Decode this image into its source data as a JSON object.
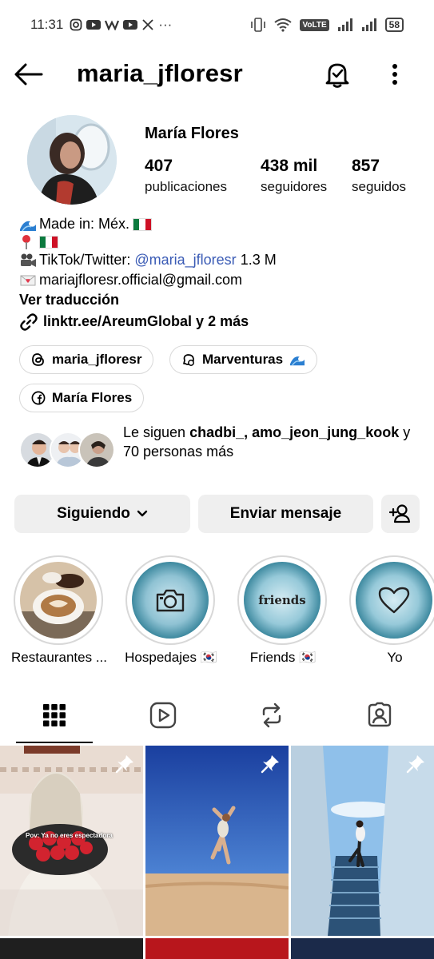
{
  "status_bar": {
    "time": "11:31",
    "app_icons": [
      "instagram-icon",
      "youtube-icon",
      "w-icon",
      "youtube-icon",
      "x-icon"
    ],
    "more": "···",
    "network_label": "VoLTE",
    "battery": "58"
  },
  "header": {
    "username": "maria_jfloresr",
    "back_icon": "arrow-left-icon",
    "bell_icon": "bell-check-icon",
    "menu_icon": "vertical-dots-icon"
  },
  "profile": {
    "display_name": "María Flores",
    "stats": [
      {
        "value": "407",
        "label": "publicaciones"
      },
      {
        "value": "438 mil",
        "label": "seguidores"
      },
      {
        "value": "857",
        "label": "seguidos"
      }
    ]
  },
  "bio": {
    "line1": "Made in: Méx.",
    "line3_prefix": "TikTok/Twitter:",
    "line3_mention": "@maria_jfloresr",
    "line3_suffix": "1.3 M",
    "email": "mariajfloresr.official@gmail.com",
    "translate": "Ver traducción",
    "link": "linktr.ee/AreumGlobal y 2 más"
  },
  "chips": [
    {
      "label": "maria_jfloresr",
      "icon": "threads-icon"
    },
    {
      "label": "Marventuras",
      "icon": "speech-bubble-icon"
    },
    {
      "label": "María Flores",
      "icon": "facebook-icon"
    }
  ],
  "followed_by": {
    "prefix": "Le siguen",
    "user1": "chadbi_",
    "user2": "amo_jeon_jung_kook",
    "suffix": "y 70 personas más"
  },
  "actions": {
    "following": "Siguiendo",
    "message": "Enviar mensaje",
    "add_person_icon": "add-person-icon"
  },
  "highlights": [
    {
      "label": "Restaurantes ...",
      "icon": "coffee-photo"
    },
    {
      "label": "Hospedajes 🇰🇷",
      "icon": "camera-icon"
    },
    {
      "label": "Friends 🇰🇷",
      "icon": "friends-text",
      "inner_text": "friends"
    },
    {
      "label": "Yo",
      "icon": "heart-icon"
    }
  ],
  "tabs": [
    {
      "name": "grid-icon",
      "active": true
    },
    {
      "name": "reels-icon",
      "active": false
    },
    {
      "name": "reposts-icon",
      "active": false
    },
    {
      "name": "tagged-icon",
      "active": false
    }
  ],
  "posts": [
    {
      "caption": "Pov: Ya no eres espectadora",
      "pinned": true
    },
    {
      "caption": "",
      "pinned": true
    },
    {
      "caption": "",
      "pinned": true
    }
  ],
  "colors": {
    "mention": "#3a5bb5",
    "button_bg": "#efefef",
    "chip_border": "#d9d9d9"
  }
}
